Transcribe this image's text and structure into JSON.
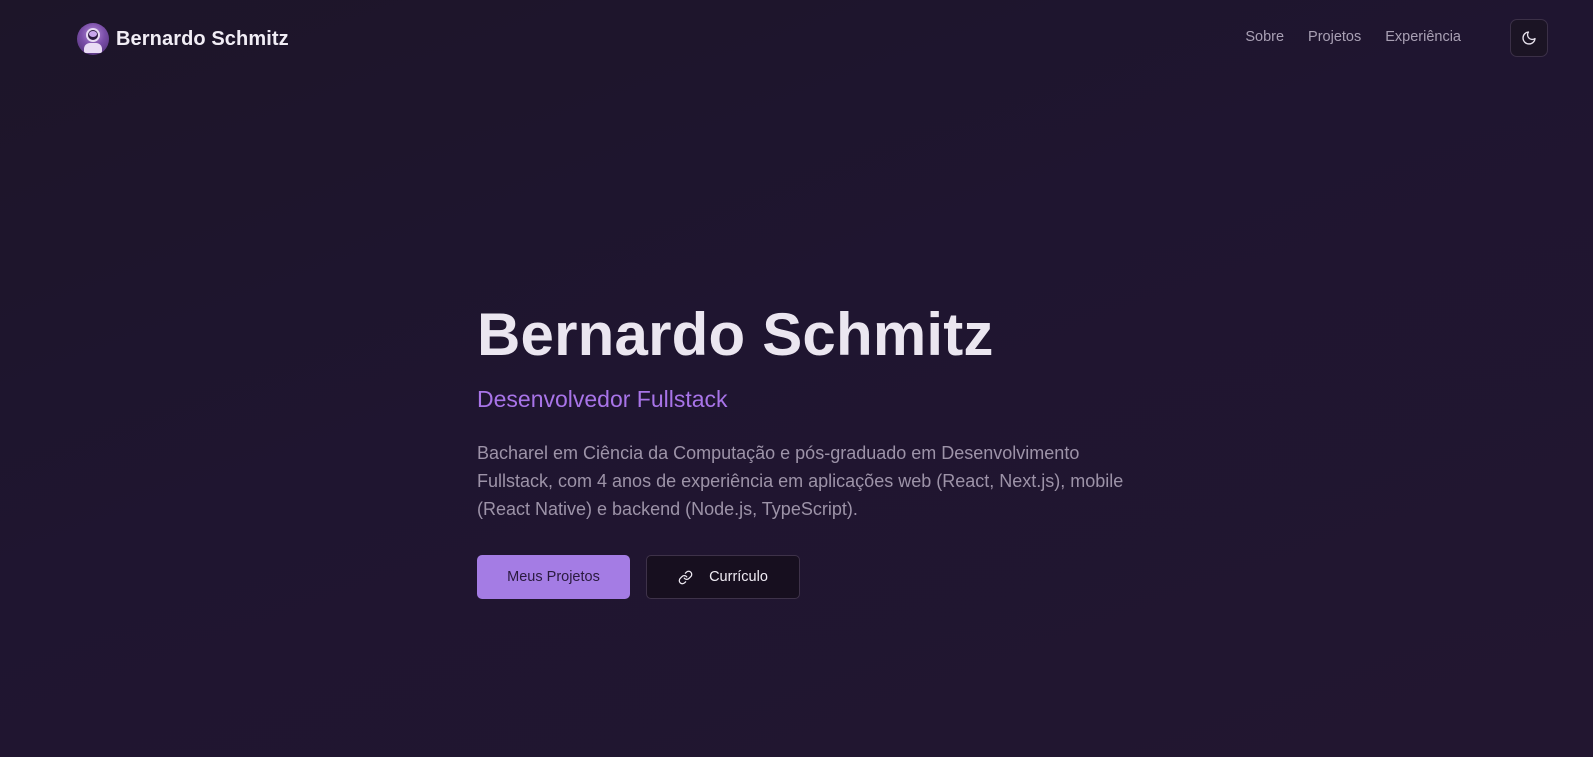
{
  "header": {
    "brand_name": "Bernardo Schmitz",
    "nav": [
      {
        "label": "Sobre"
      },
      {
        "label": "Projetos"
      },
      {
        "label": "Experiência"
      }
    ],
    "theme_toggle_icon": "moon-icon"
  },
  "hero": {
    "title": "Bernardo Schmitz",
    "subtitle": "Desenvolvedor Fullstack",
    "description": "Bacharel em Ciência da Computação e pós-graduado em Desenvolvimento Fullstack, com 4 anos de experiência em aplicações web (React, Next.js), mobile (React Native) e backend (Node.js, TypeScript).",
    "primary_button": "Meus Projetos",
    "secondary_button": "Currículo",
    "secondary_button_icon": "link-icon"
  },
  "colors": {
    "background": "#1f1530",
    "accent": "#a874e8",
    "primary_button_bg": "#a47ce4",
    "text_muted": "#9d93a8"
  }
}
